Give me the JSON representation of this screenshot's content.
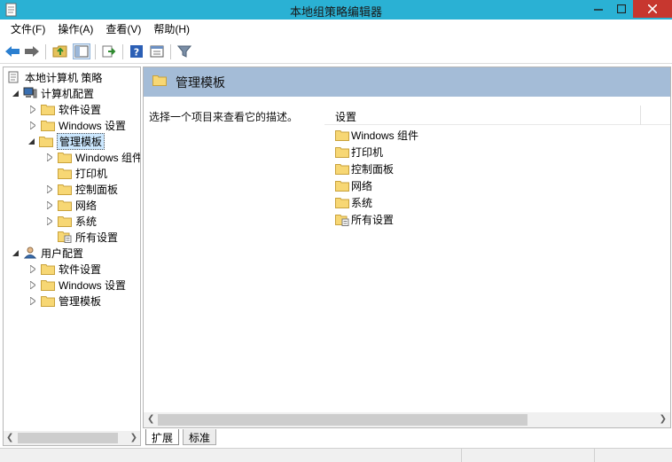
{
  "window": {
    "title": "本地组策略编辑器",
    "accent": "#2ab1d4",
    "close_color": "#c7372f"
  },
  "menu": [
    "文件(F)",
    "操作(A)",
    "查看(V)",
    "帮助(H)"
  ],
  "toolbar": {
    "icons": [
      "back-arrow-icon",
      "forward-arrow-icon",
      "up-folder-icon",
      "show-hide-tree-icon",
      "export-list-icon",
      "help-icon",
      "properties-icon",
      "filter-icon"
    ]
  },
  "tree": {
    "root": "本地计算机 策略",
    "computer_config": "计算机配置",
    "software_settings": "软件设置",
    "windows_settings": "Windows 设置",
    "admin_templates": "管理模板",
    "windows_components": "Windows 组件",
    "printers": "打印机",
    "control_panel": "控制面板",
    "network": "网络",
    "system": "系统",
    "all_settings": "所有设置",
    "user_config": "用户配置",
    "user_software_settings": "软件设置",
    "user_windows_settings": "Windows 设置",
    "user_admin_templates": "管理模板"
  },
  "right": {
    "header_title": "管理模板",
    "description": "选择一个项目来查看它的描述。",
    "column_header": "设置",
    "header_color": "#a4bcd7",
    "items": [
      {
        "label": "Windows 组件",
        "icon": "folder-icon"
      },
      {
        "label": "打印机",
        "icon": "folder-icon"
      },
      {
        "label": "控制面板",
        "icon": "folder-icon"
      },
      {
        "label": "网络",
        "icon": "folder-icon"
      },
      {
        "label": "系统",
        "icon": "folder-icon"
      },
      {
        "label": "所有设置",
        "icon": "all-settings-icon"
      }
    ]
  },
  "tabs": {
    "extended": "扩展",
    "standard": "标准"
  }
}
